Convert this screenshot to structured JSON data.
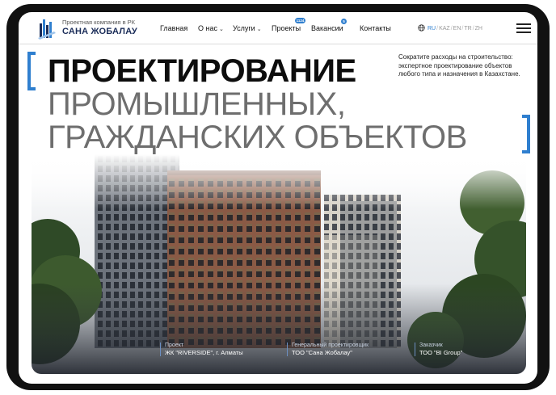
{
  "header": {
    "logo_subtitle": "Проектная компания в РК",
    "logo_name": "САНА ЖОБАЛАУ",
    "nav": [
      {
        "label": "Главная"
      },
      {
        "label": "О нас"
      },
      {
        "label": "Услуги"
      },
      {
        "label": "Проекты",
        "badge": "1124"
      },
      {
        "label": "Вакансии",
        "badge": "5"
      },
      {
        "label": "Контакты"
      }
    ],
    "languages": [
      "RU",
      "KAZ",
      "EN",
      "TR",
      "ZH"
    ],
    "active_language": "RU"
  },
  "hero": {
    "line1": "ПРОЕКТИРОВАНИЕ",
    "line2": "ПРОМЫШЛЕННЫХ,",
    "line3": "ГРАЖДАНСКИХ ОБЪЕКТОВ",
    "tagline": "Сократите расходы на строительство: экспертное проектирование объектов любого типа и назначения в Казахстане.",
    "info": [
      {
        "label": "Проект",
        "value": "ЖК \"RIVERSIDE\", г. Алматы"
      },
      {
        "label": "Генеральный проектировщик",
        "value": "ТОО \"Сана Жобалау\""
      },
      {
        "label": "Заказчик",
        "value": "ТОО \"BI Group\""
      }
    ]
  },
  "colors": {
    "accent": "#2f7fcf",
    "brand_dark": "#1b2d59",
    "frame": "#111111"
  }
}
